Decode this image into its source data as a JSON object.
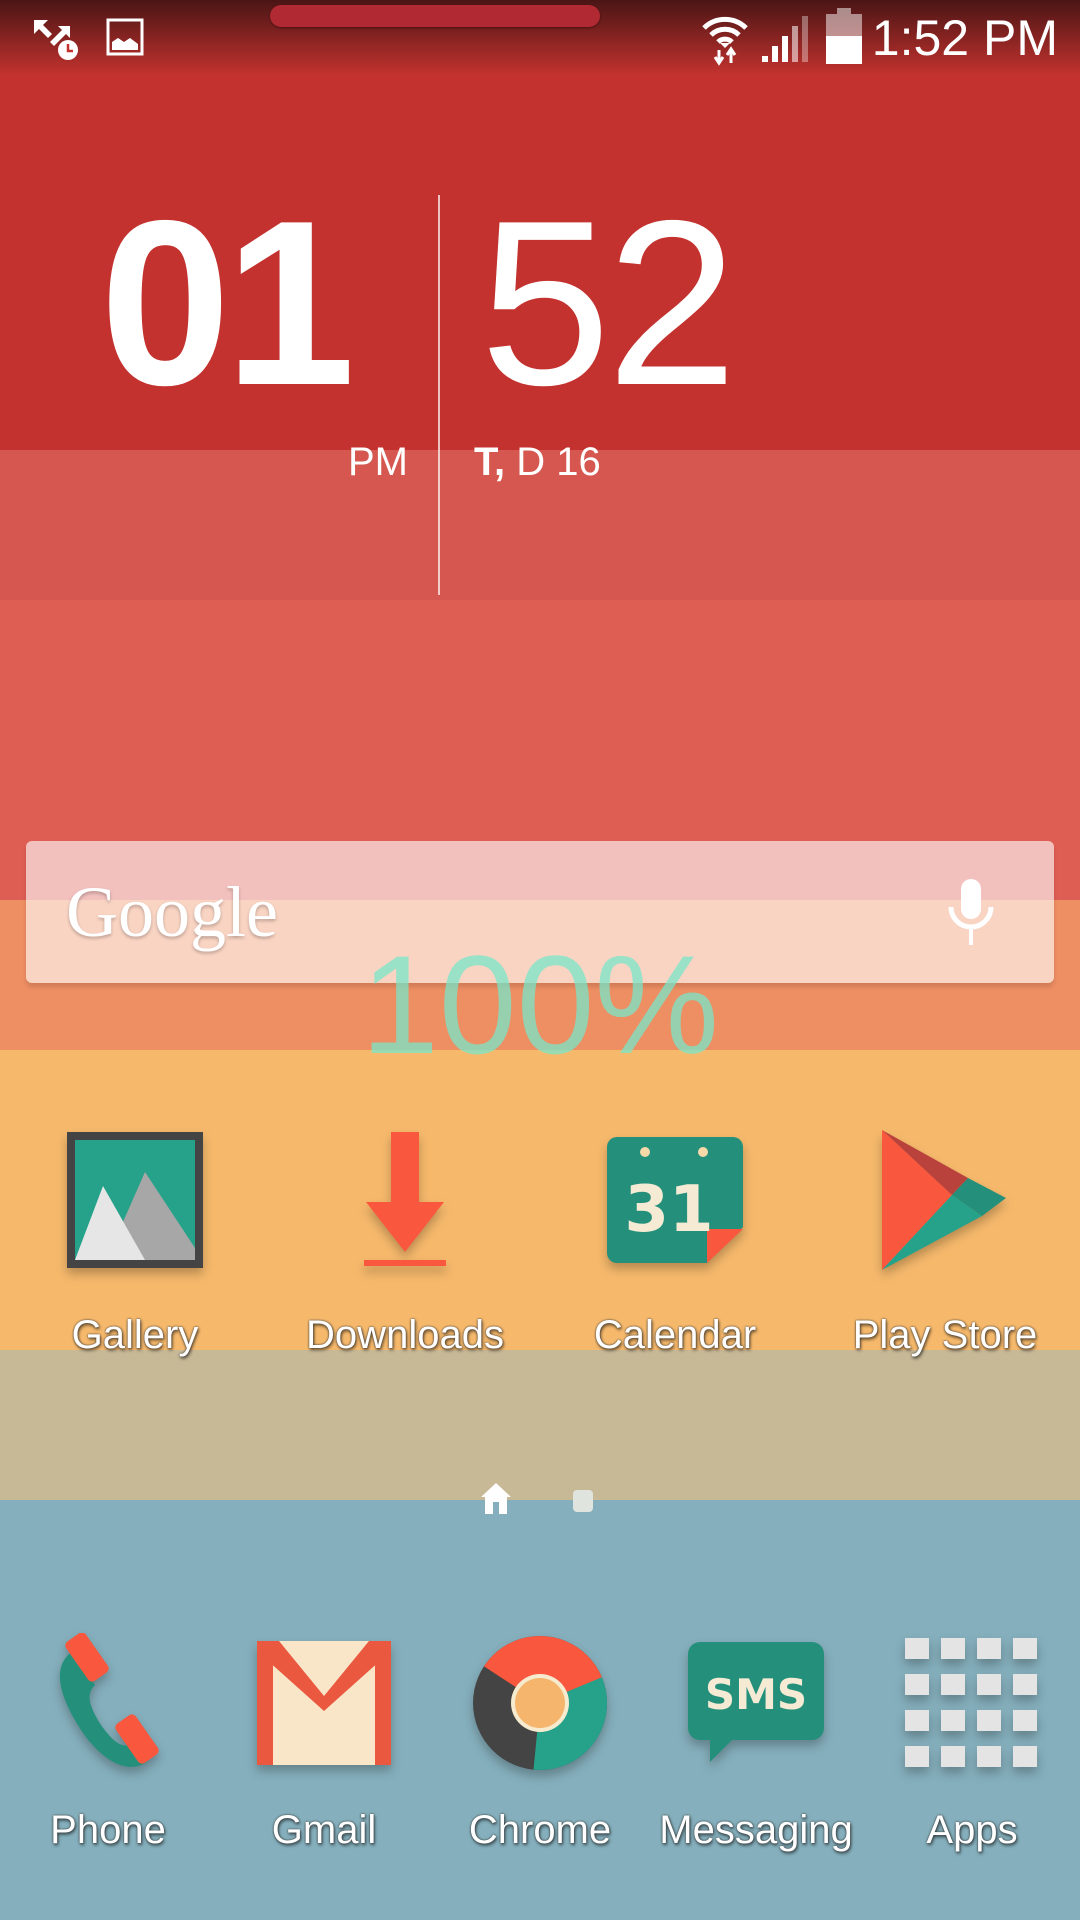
{
  "status_bar": {
    "left_icons": [
      "data-sync-icon",
      "image-notification-icon"
    ],
    "right_icons": [
      "wifi-icon",
      "signal-icon",
      "battery-icon"
    ],
    "time": "1:52 PM"
  },
  "clock_widget": {
    "hour": "01",
    "minute": "52",
    "ampm": "PM",
    "day_abbrev": "T,",
    "date_rest": " D 16"
  },
  "search_widget": {
    "logo_text": "Google",
    "mic_icon": "microphone-icon"
  },
  "battery_overlay": {
    "text": "100%",
    "level_percent": 100
  },
  "home_apps": [
    {
      "label": "Gallery",
      "icon": "gallery-icon"
    },
    {
      "label": "Downloads",
      "icon": "download-icon"
    },
    {
      "label": "Calendar",
      "icon": "calendar-icon",
      "icon_text": "31"
    },
    {
      "label": "Play Store",
      "icon": "play-store-icon"
    }
  ],
  "pager": {
    "pages": 2,
    "current": 1,
    "home_icon": "home-icon"
  },
  "dock_apps": [
    {
      "label": "Phone",
      "icon": "phone-icon"
    },
    {
      "label": "Gmail",
      "icon": "gmail-icon"
    },
    {
      "label": "Chrome",
      "icon": "chrome-icon"
    },
    {
      "label": "Messaging",
      "icon": "sms-icon",
      "icon_text": "SMS"
    },
    {
      "label": "Apps",
      "icon": "app-drawer-icon"
    }
  ],
  "colors": {
    "band_1": "#c3322e",
    "band_2": "#d5574f",
    "band_3": "#de5e54",
    "band_4": "#ee8e63",
    "band_5": "#f6b96c",
    "band_6": "#c7b896",
    "band_7": "#85afbc",
    "teal": "#249a84",
    "accent_orange": "#f9573e"
  }
}
